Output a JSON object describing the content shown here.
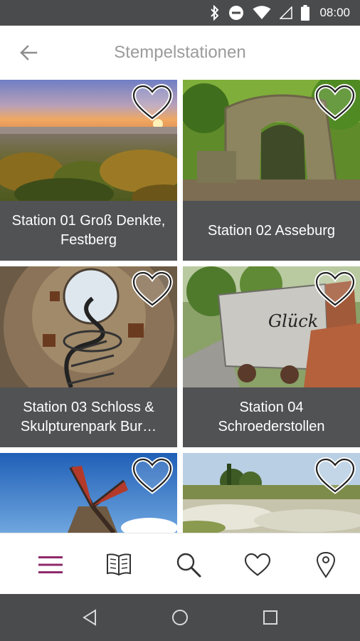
{
  "status_bar": {
    "time": "08:00",
    "icons": [
      "bluetooth-icon",
      "do-not-disturb-icon",
      "wifi-icon",
      "signal-icon",
      "battery-icon"
    ]
  },
  "header": {
    "title": "Stempelstationen",
    "back_icon": "arrow-left-icon"
  },
  "stations": [
    {
      "label": "Station 01 Groß Denkte, Festberg",
      "favorite": false,
      "image": "sunset-forest-panorama"
    },
    {
      "label": "Station 02 Asseburg",
      "favorite": false,
      "image": "stone-ruin-arch"
    },
    {
      "label": "Station 03 Schloss & Skulpturenpark Bur…",
      "favorite": false,
      "image": "spiral-staircase-tower"
    },
    {
      "label": "Station 04 Schroederstollen",
      "favorite": false,
      "image": "mine-cart"
    },
    {
      "label": "",
      "favorite": false,
      "image": "windmill"
    },
    {
      "label": "",
      "favorite": false,
      "image": "meadow-landscape"
    }
  ],
  "bottom_nav": {
    "items": [
      "menu-icon",
      "book-icon",
      "search-icon",
      "heart-icon",
      "location-pin-icon"
    ],
    "active": "menu-icon",
    "active_color": "#8e2a6b"
  },
  "system_nav": [
    "back-triangle-icon",
    "home-circle-icon",
    "recents-square-icon"
  ],
  "colors": {
    "caption_bg": "#515254",
    "status_bar": "#4a4b4d",
    "title_gray": "#9b9b9b"
  }
}
